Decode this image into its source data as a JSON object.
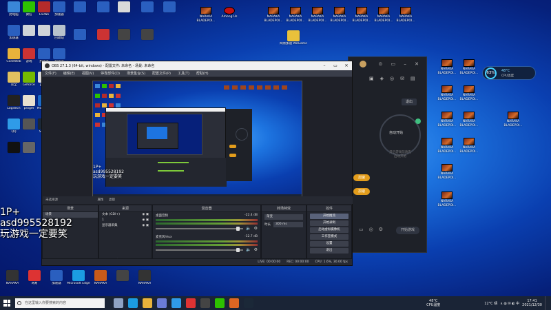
{
  "desktop": {
    "icons_left": [
      {
        "label": "此电脑",
        "color": "#3a86d8"
      },
      {
        "label": "微信",
        "color": "#2dc100"
      },
      {
        "label": "LoLWe",
        "color": "#b52b2b"
      },
      {
        "label": "加速器",
        "color": "#2a5fbf"
      },
      {
        "label": "加速器",
        "color": "#2a5fbf"
      },
      {
        "label": "",
        "color": "#cfd3d8"
      },
      {
        "label": "",
        "color": "#cfd3d8"
      },
      {
        "label": "回收站",
        "color": "#b8c2cc"
      },
      {
        "label": "CodeWeb",
        "color": "#e9b33b"
      },
      {
        "label": "游戏",
        "color": "#c33"
      },
      {
        "label": "加速器",
        "color": "#2a5fbf"
      },
      {
        "label": "加速器",
        "color": "#2a5fbf"
      },
      {
        "label": "完全",
        "color": "#e0c060"
      },
      {
        "label": "Geforce",
        "color": "#76b900"
      },
      {
        "label": "panic",
        "color": "#d9d9d9"
      },
      {
        "label": "",
        "color": "#111"
      },
      {
        "label": "Logitech",
        "color": "#222"
      },
      {
        "label": "progm",
        "color": "#e8e0d0"
      },
      {
        "label": "Microsoft",
        "color": "#1b6ac9"
      },
      {
        "label": "游戏",
        "color": "#c33"
      },
      {
        "label": "QQ",
        "color": "#2f9be8"
      },
      {
        "label": "",
        "color": "#555"
      },
      {
        "label": "Steam",
        "color": "#1b2838"
      },
      {
        "label": "",
        "color": "#555"
      },
      {
        "label": "",
        "color": "#111"
      },
      {
        "label": "",
        "color": "#666"
      }
    ],
    "icons_bottom": [
      {
        "label": "NARAKA",
        "color": "#333"
      },
      {
        "label": "网易",
        "color": "#d33"
      },
      {
        "label": "加速器",
        "color": "#2a5fbf"
      },
      {
        "label": "Microsoft Edge",
        "color": "#1b9de2"
      },
      {
        "label": "NARAKA",
        "color": "#c85a1a"
      },
      {
        "label": "",
        "color": "#444"
      },
      {
        "label": "NARAKA",
        "color": "#333"
      }
    ],
    "top_game_labels": [
      "NARAKA BLADEPOI...",
      "Among Us",
      "NARAKA BLADEPOI...",
      "NARAKA BLADEPOI...",
      "NARAKA BLADEPOI...",
      "NARAKA BLADEPOI...",
      "NARAKA BLADEPOI...",
      "NARAKA BLADEPOI...",
      "NARAKA BLADEPOI..."
    ],
    "right_game_labels": [
      "NARAKA BLADEPOI...",
      "NARAKA BLADEPOI...",
      "NARAKA BLADEPOI...",
      "NARAKA BLADEPOI...",
      "NARAKA BLADEPOI...",
      "NARAKA BLADEPOI...",
      "NARAKA BLADEPOI...",
      "NARAKA BLADEPOI...",
      "NARAKA BLADEPOI...",
      "NARAKA BLADEPOI...",
      "NARAKA BLADEPOI..."
    ],
    "folder_label": "网易加速 WeGame"
  },
  "widget": {
    "percent": "63%",
    "temp": "48°C",
    "label": "CPU温度"
  },
  "launcher": {
    "button_top": "退出",
    "circle_label": "自动开始",
    "note_line1": "开启游戏前请先",
    "note_line2": "启动开始",
    "pill1": "加速",
    "pill2": "加速",
    "bottom_button": "开始游戏"
  },
  "obs": {
    "title": "OBS 27.1.3 (64-bit, windows) - 配置文件: 未命名 - 场景: 未命名",
    "menu": [
      "文件(F)",
      "编辑(E)",
      "视图(V)",
      "停靠部件(D)",
      "场景集合(S)",
      "配置文件(P)",
      "工具(T)",
      "帮助(H)"
    ],
    "preview_inner_title": "OBS",
    "scenes_title": "场景",
    "scene_item": "场景",
    "sources_title": "来源",
    "sources": [
      {
        "label": "文本 (GDI+)"
      },
      {
        "label": "1"
      },
      {
        "label": "显示器采集"
      }
    ],
    "selected_source_label": "未选择源",
    "props_button": "属性",
    "filters_button": "滤镜",
    "mixer_title": "混音器",
    "mixer_tracks": [
      {
        "name": "桌面音频",
        "level": "-22.4 dB"
      },
      {
        "name": "麦克风/Aux",
        "level": "-12.7 dB"
      }
    ],
    "transitions_title": "转场特效",
    "transition_type": "渐变",
    "duration_label": "时长",
    "duration_value": "300 ms",
    "controls_title": "控件",
    "controls": [
      {
        "label": "开始推流",
        "active": true
      },
      {
        "label": "开始录制",
        "active": false
      },
      {
        "label": "启动虚拟摄像机",
        "active": false
      },
      {
        "label": "工作室模式",
        "active": false
      },
      {
        "label": "设置",
        "active": false
      },
      {
        "label": "退出",
        "active": false
      }
    ],
    "status": {
      "live": "LIVE: 00:00:00",
      "rec": "REC: 00:00:00",
      "cpu": "CPU: 1.6%, 30.00 fps"
    }
  },
  "overlay": {
    "line1": "1P+",
    "line2": "asd995528192",
    "line3": "玩游戏一定要笑"
  },
  "taskbar": {
    "search_placeholder": "在这里输入你要搜索的内容",
    "weather": "12°C 晴",
    "cpu_temp": "48°C",
    "cpu_temp_label": "CPU温度",
    "time": "17:41",
    "date": "2021/12/30",
    "apps": [
      {
        "name": "task-view",
        "color": "#8ea3c4"
      },
      {
        "name": "edge",
        "color": "#1b9de2"
      },
      {
        "name": "explorer",
        "color": "#e9b33b"
      },
      {
        "name": "store",
        "color": "#6b7cd6"
      },
      {
        "name": "qq",
        "color": "#2f9be8"
      },
      {
        "name": "netease",
        "color": "#d33"
      },
      {
        "name": "obs",
        "color": "#444"
      },
      {
        "name": "wechat",
        "color": "#2dc100"
      },
      {
        "name": "wegame",
        "color": "#dd6622"
      },
      {
        "name": "steam",
        "color": "#1b2838"
      }
    ]
  }
}
